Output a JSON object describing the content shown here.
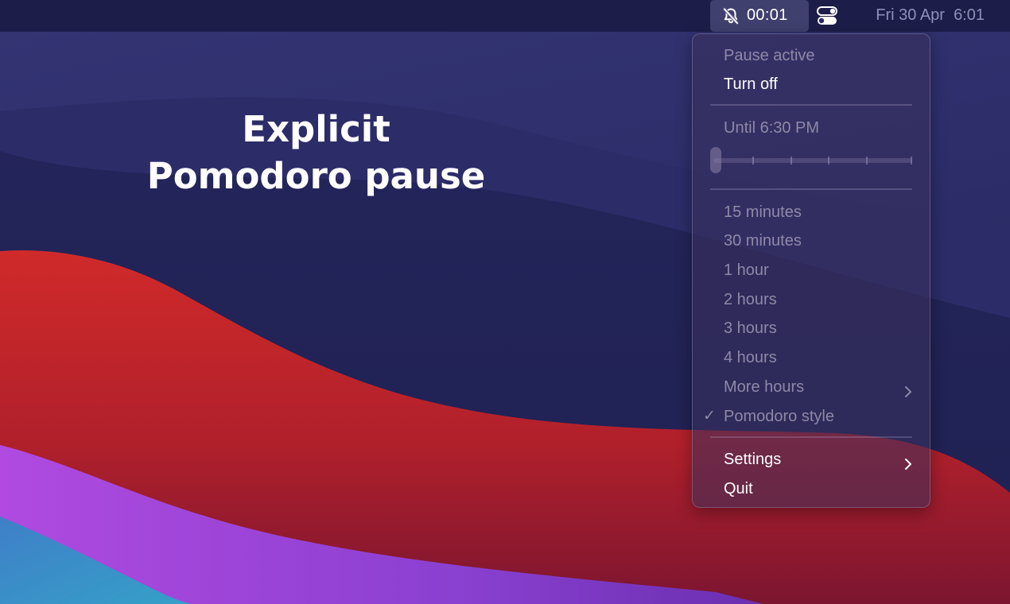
{
  "menubar": {
    "status_item": {
      "icon": "bell-slash-icon",
      "timer": "00:01"
    },
    "control_center_icon": "toggle-switches-icon",
    "clock": "Fri 30 Apr  6:01"
  },
  "caption": {
    "line1": "Explicit",
    "line2": "Pomodoro pause"
  },
  "menu": {
    "status": "Pause active",
    "turn_off": "Turn off",
    "until_label": "Until 6:30 PM",
    "slider": {
      "value": 0,
      "tick_count": 6
    },
    "durations": [
      "15 minutes",
      "30 minutes",
      "1 hour",
      "2 hours",
      "3 hours",
      "4 hours"
    ],
    "more_hours": "More hours",
    "pomodoro_style": "Pomodoro style",
    "pomodoro_checked": true,
    "checkmark": "✓",
    "settings": "Settings",
    "quit": "Quit"
  },
  "colors": {
    "menubar_bg": "#1c1c46",
    "menu_enabled_text": "#ffffff",
    "menu_disabled_text": "#8e88a8",
    "wallpaper_red": "#c8242c",
    "wallpaper_purple": "#9b45d8",
    "wallpaper_navy": "#232458"
  }
}
